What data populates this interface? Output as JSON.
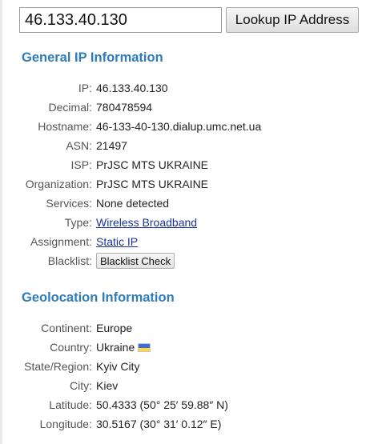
{
  "search": {
    "value": "46.133.40.130",
    "button_label": "Lookup IP Address"
  },
  "general": {
    "title": "General IP Information",
    "rows": [
      {
        "label": "IP:",
        "value": "46.133.40.130"
      },
      {
        "label": "Decimal:",
        "value": "780478594"
      },
      {
        "label": "Hostname:",
        "value": "46-133-40-130.dialup.umc.net.ua"
      },
      {
        "label": "ASN:",
        "value": "21497"
      },
      {
        "label": "ISP:",
        "value": "PrJSC MTS UKRAINE"
      },
      {
        "label": "Organization:",
        "value": "PrJSC MTS UKRAINE"
      },
      {
        "label": "Services:",
        "value": "None detected"
      },
      {
        "label": "Type:",
        "value": "Wireless Broadband"
      },
      {
        "label": "Assignment:",
        "value": "Static IP"
      },
      {
        "label": "Blacklist:",
        "value": "Blacklist Check"
      }
    ]
  },
  "geolocation": {
    "title": "Geolocation Information",
    "rows": [
      {
        "label": "Continent:",
        "value": "Europe"
      },
      {
        "label": "Country:",
        "value": "Ukraine",
        "flag_icon": "flag-ukraine-icon"
      },
      {
        "label": "State/Region:",
        "value": "Kyiv City"
      },
      {
        "label": "City:",
        "value": "Kiev"
      },
      {
        "label": "Latitude:",
        "value": "50.4333  (50° 25′ 59.88″ N)"
      },
      {
        "label": "Longitude:",
        "value": "30.5167  (30° 31′ 0.12″ E)"
      }
    ]
  },
  "colors": {
    "section_title": "#2e7db8",
    "link": "#1a3399",
    "flag_blue": "#3d6fd6",
    "flag_yellow": "#ffd83a"
  }
}
